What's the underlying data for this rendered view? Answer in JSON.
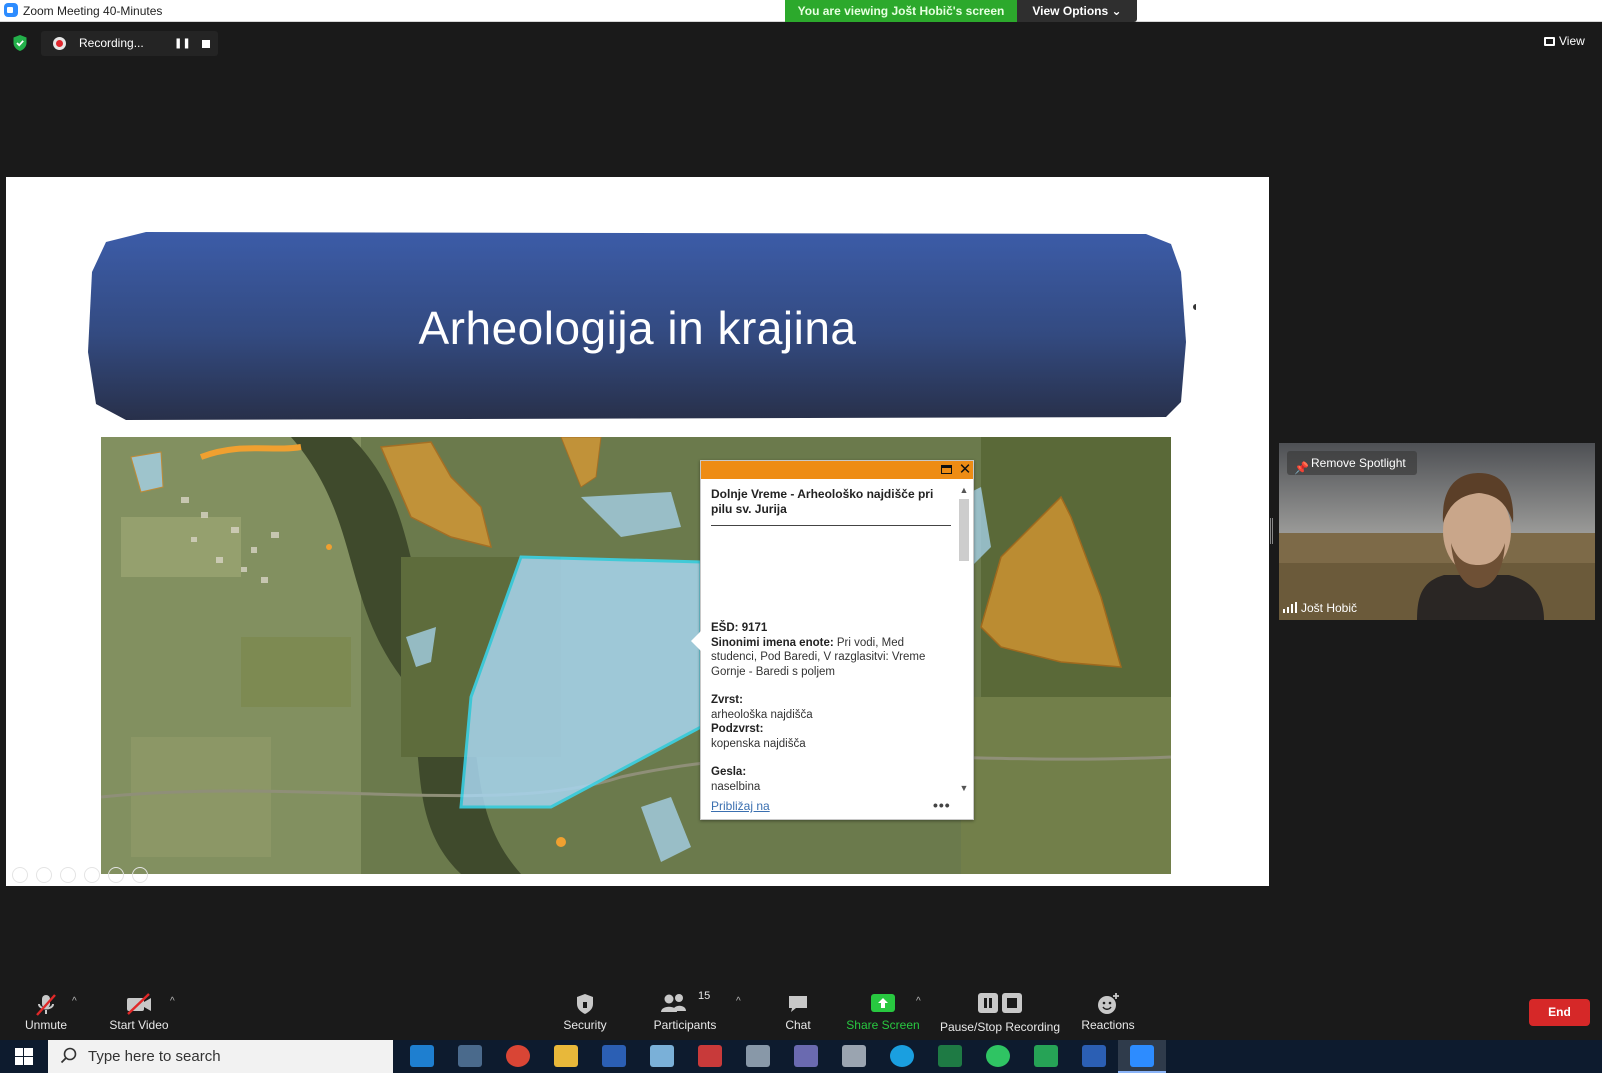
{
  "window": {
    "title": "Zoom Meeting 40-Minutes"
  },
  "banner": {
    "viewing_text": "You are viewing Jošt Hobič's screen",
    "view_options_label": "View Options"
  },
  "recording": {
    "label": "Recording...",
    "pause_label": "❚❚"
  },
  "top_right": {
    "view_label": "View"
  },
  "slide": {
    "title": "Arheologija in krajina"
  },
  "popup": {
    "title": "Dolnje Vreme - Arheološko najdišče pri pilu sv. Jurija",
    "esd_label": "EŠD:",
    "esd_value": "9171",
    "synonyms_label": "Sinonimi imena enote:",
    "synonyms_value": "Pri vodi, Med studenci, Pod Baredi, V razglasitvi: Vreme Gornje - Baredi s poljem",
    "type_label": "Zvrst:",
    "type_value": "arheološka najdišča",
    "subtype_label": "Podzvrst:",
    "subtype_value": "kopenska najdišča",
    "keywords_label": "Gesla:",
    "keywords_value": "naselbina",
    "zoom_link": "Približaj na",
    "more_label": "•••"
  },
  "participant": {
    "name": "Jošt Hobič",
    "spotlight_label": "Remove Spotlight"
  },
  "toolbar": {
    "unmute": "Unmute",
    "start_video": "Start Video",
    "security": "Security",
    "participants": "Participants",
    "participants_count": "15",
    "chat": "Chat",
    "share_screen": "Share Screen",
    "pause_stop_recording": "Pause/Stop Recording",
    "reactions": "Reactions",
    "end": "End"
  },
  "taskbar": {
    "search_placeholder": "Type here to search",
    "apps": [
      "mail-icon",
      "calculator-icon",
      "chrome-icon",
      "file-explorer-icon",
      "word-icon",
      "paint-icon",
      "library-icon",
      "windows-icon",
      "archive-icon",
      "document-icon",
      "skype-icon",
      "excel-icon",
      "whatsapp-icon",
      "sheets-icon",
      "word-icon",
      "zoom-icon"
    ]
  },
  "colors": {
    "share_banner": "#2ca92c",
    "popup_header": "#ee8c14",
    "end_button": "#d62828",
    "share_screen_icon": "#28c840",
    "slide_banner": "#3a5aa0",
    "map_polygon_orange": "#f0a030",
    "map_polygon_blue": "#a8d6f0"
  }
}
